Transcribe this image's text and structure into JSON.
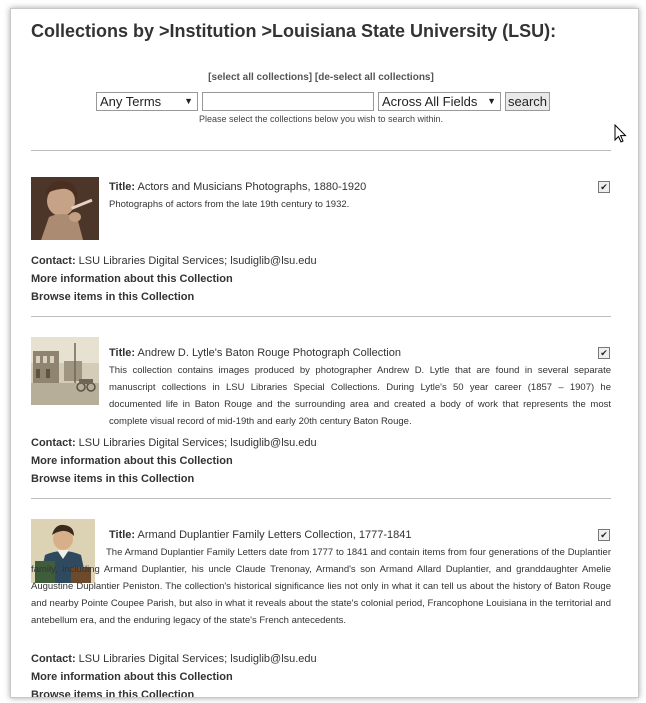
{
  "page_title": "Collections by >Institution >Louisiana State University (LSU):",
  "select_all": "[select all collections]",
  "deselect_all": "[de-select all collections]",
  "search": {
    "terms_option": "Any Terms",
    "fields_option": "Across All Fields",
    "query": "",
    "button_label": "search",
    "hint": "Please select the collections below you wish to search within."
  },
  "labels": {
    "title": "Title:",
    "contact": "Contact:",
    "more_info": "More information about this Collection",
    "browse": "Browse items in this Collection"
  },
  "collections": [
    {
      "title": "Actors and Musicians Photographs, 1880-1920",
      "description": "Photographs of actors from the late 19th century to 1932.",
      "contact": "LSU Libraries Digital Services; lsudiglib@lsu.edu",
      "checked": true
    },
    {
      "title": "Andrew D. Lytle's Baton Rouge Photograph Collection",
      "description": "This collection contains images produced by photographer Andrew D. Lytle that are found in several separate manuscript collections in LSU Libraries Special Collections. During Lytle's 50 year career (1857 – 1907) he documented life in Baton Rouge and the surrounding area and created a body of work that represents the most complete visual record of mid-19th and early 20th century Baton Rouge.",
      "contact": "LSU Libraries Digital Services; lsudiglib@lsu.edu",
      "checked": true
    },
    {
      "title": "Armand Duplantier Family Letters Collection, 1777-1841",
      "description": "The Armand Duplantier Family Letters date from 1777 to 1841 and contain items from four generations of the Duplantier family, including Armand Duplantier, his uncle Claude Trenonay, Armand's son Armand Allard Duplantier, and granddaughter Amelie Augustine Duplantier Peniston. The collection's historical significance lies not only in what it can tell us about the history of Baton Rouge and nearby Pointe Coupee Parish, but also in what it reveals about the state's colonial period, Francophone Louisiana in the territorial and antebellum era, and the enduring legacy of the state's French antecedents.",
      "contact": "LSU Libraries Digital Services; lsudiglib@lsu.edu",
      "checked": true
    }
  ]
}
